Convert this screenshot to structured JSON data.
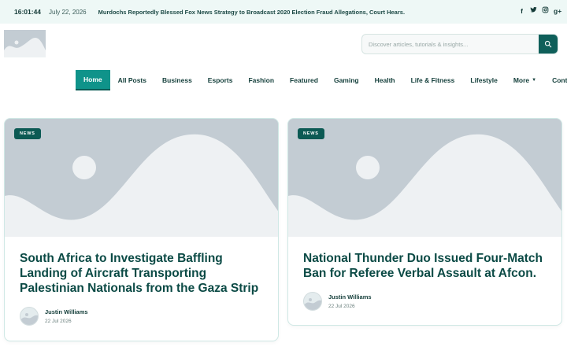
{
  "topbar": {
    "time": "16:01:44",
    "date": "July 22, 2026",
    "headline": "Murdochs Reportedly Blessed Fox News Strategy to Broadcast 2020 Election Fraud Allegations, Court Hears.",
    "social": [
      {
        "icon": "facebook-icon",
        "glyph": "f"
      },
      {
        "icon": "twitter-icon",
        "glyph": "t"
      },
      {
        "icon": "instagram-icon",
        "glyph": "◎"
      },
      {
        "icon": "google-plus-icon",
        "glyph": "g+"
      }
    ]
  },
  "search": {
    "placeholder": "Discover articles, tutorials & insights...",
    "value": ""
  },
  "nav": {
    "items": [
      {
        "label": "Home",
        "active": true
      },
      {
        "label": "All Posts"
      },
      {
        "label": "Business"
      },
      {
        "label": "Esports"
      },
      {
        "label": "Fashion"
      },
      {
        "label": "Featured"
      },
      {
        "label": "Gaming"
      },
      {
        "label": "Health"
      },
      {
        "label": "Life & Fitness"
      },
      {
        "label": "Lifestyle"
      },
      {
        "label": "More"
      },
      {
        "label": "Contact Us"
      }
    ]
  },
  "cards": [
    {
      "badge": "NEWS",
      "title": "South Africa to Investigate Baffling Landing of Aircraft Transporting Palestinian Nationals from the Gaza Strip",
      "author": "Justin Williams",
      "date": "22 Jul 2026"
    },
    {
      "badge": "NEWS",
      "title": "National Thunder Duo Issued Four-Match Ban for Referee Verbal Assault at Afcon.",
      "author": "Justin Williams",
      "date": "22 Jul 2026"
    }
  ],
  "colors": {
    "accent": "#0f938a",
    "dark": "#0b4a45",
    "topbar_bg": "#eef8f6"
  }
}
